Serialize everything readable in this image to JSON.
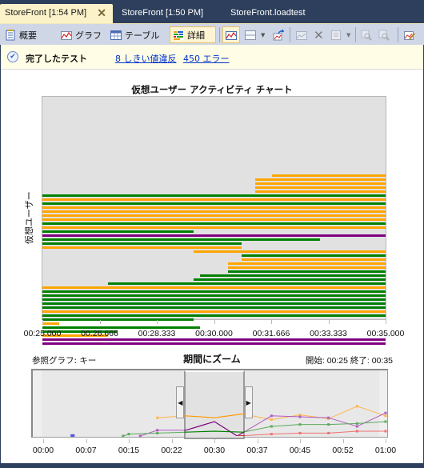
{
  "tabs": [
    {
      "label": "StoreFront [1:54 PM]",
      "active": true,
      "closable": true
    },
    {
      "label": "StoreFront [1:50 PM]",
      "active": false
    },
    {
      "label": "StoreFront.loadtest",
      "active": false
    }
  ],
  "toolbar": {
    "summary_label": "概要",
    "graph_label": "グラフ",
    "table_label": "テーブル",
    "details_label": "詳細",
    "icons": [
      "summary-icon",
      "graph-icon",
      "table-icon",
      "details-icon",
      "graph-view-icon",
      "layout-icon",
      "dropdown-icon",
      "export-icon",
      "add-graph-icon",
      "delete-icon",
      "properties-icon",
      "dropdown-icon",
      "zoom-in-icon",
      "zoom-out-icon",
      "edit-graph-icon"
    ]
  },
  "infobar": {
    "status": "完了したテスト",
    "threshold_link": "8 しきい値違反",
    "errors_link": "450 エラー"
  },
  "chart_data": {
    "type": "bar",
    "title": "仮想ユーザー アクティビティ チャート",
    "ylabel": "仮想ユーザー",
    "xlabel": "",
    "x_range_seconds": [
      25,
      35
    ],
    "x_tick_labels": [
      "00:25.000",
      "00:26.666",
      "00:28.333",
      "00:30.000",
      "00:31.666",
      "00:33.333",
      "00:35.000"
    ],
    "colors": {
      "passed": "#008000",
      "other": "#ffa500",
      "failed": "#800080"
    },
    "series": [
      {
        "color": "orange",
        "start": 31.7,
        "end": 35
      },
      {
        "color": "orange",
        "start": 31.2,
        "end": 35
      },
      {
        "color": "orange",
        "start": 31.2,
        "end": 35
      },
      {
        "color": "orange",
        "start": 31.2,
        "end": 35
      },
      {
        "color": "orange",
        "start": 31.2,
        "end": 35
      },
      {
        "color": "green",
        "start": 25,
        "end": 35
      },
      {
        "color": "orange",
        "start": 25,
        "end": 35
      },
      {
        "color": "green",
        "start": 25,
        "end": 35
      },
      {
        "color": "orange",
        "start": 25,
        "end": 35
      },
      {
        "color": "orange",
        "start": 25,
        "end": 35
      },
      {
        "color": "orange",
        "start": 25,
        "end": 35
      },
      {
        "color": "orange",
        "start": 25,
        "end": 35
      },
      {
        "color": "green",
        "start": 25,
        "end": 35
      },
      {
        "color": "orange",
        "start": 25,
        "end": 35
      },
      {
        "color": "green",
        "start": 25,
        "end": 29.4
      },
      {
        "color": "purple",
        "start": 25,
        "end": 35
      },
      {
        "color": "green",
        "start": 25,
        "end": 33.1
      },
      {
        "color": "green",
        "start": 25,
        "end": 30.8
      },
      {
        "color": "orange",
        "start": 25,
        "end": 30.8
      },
      {
        "color": "orange",
        "start": 29.4,
        "end": 35
      },
      {
        "color": "green",
        "start": 30.8,
        "end": 35
      },
      {
        "color": "orange",
        "start": 30.8,
        "end": 35
      },
      {
        "color": "orange",
        "start": 30.4,
        "end": 35
      },
      {
        "color": "orange",
        "start": 30.4,
        "end": 35
      },
      {
        "color": "green",
        "start": 30.4,
        "end": 35
      },
      {
        "color": "green",
        "start": 29.6,
        "end": 35
      },
      {
        "color": "green",
        "start": 29.4,
        "end": 35
      },
      {
        "color": "green",
        "start": 26.9,
        "end": 35
      },
      {
        "color": "orange",
        "start": 25,
        "end": 35
      },
      {
        "color": "green",
        "start": 25,
        "end": 35
      },
      {
        "color": "green",
        "start": 25,
        "end": 35
      },
      {
        "color": "green",
        "start": 25,
        "end": 35
      },
      {
        "color": "green",
        "start": 25,
        "end": 35
      },
      {
        "color": "green",
        "start": 25,
        "end": 35
      },
      {
        "color": "orange",
        "start": 25,
        "end": 35
      },
      {
        "color": "green",
        "start": 25,
        "end": 35
      },
      {
        "color": "green",
        "start": 25,
        "end": 29.4
      },
      {
        "color": "orange",
        "start": 25,
        "end": 25.5
      },
      {
        "color": "green",
        "start": 25,
        "end": 29.6
      },
      {
        "color": "green",
        "start": 25,
        "end": 27.2
      },
      {
        "color": "orange",
        "start": 25,
        "end": 26.9
      },
      {
        "color": "purple",
        "start": 25,
        "end": 35
      },
      {
        "color": "purple",
        "start": 25,
        "end": 35
      }
    ]
  },
  "zoom_panel": {
    "reference_label": "参照グラフ: キー",
    "title": "期間にズーム",
    "range_label": "開始: 00:25 終了: 00:35",
    "selection_start_seconds": 25,
    "selection_end_seconds": 35,
    "x_range_seconds": [
      0,
      60
    ],
    "x_tick_labels": [
      "00:00",
      "00:07",
      "00:15",
      "00:22",
      "00:30",
      "00:37",
      "00:45",
      "00:52",
      "01:00"
    ],
    "lines": [
      {
        "name": "orange",
        "color": "#ffb347",
        "points": [
          [
            20,
            0.38
          ],
          [
            25,
            0.42
          ],
          [
            30,
            0.38
          ],
          [
            35,
            0.46
          ],
          [
            40,
            0.34
          ],
          [
            45,
            0.44
          ],
          [
            50,
            0.36
          ],
          [
            55,
            0.62
          ],
          [
            60,
            0.42
          ]
        ]
      },
      {
        "name": "purple",
        "color": "#b05cc0",
        "points": [
          [
            17,
            0
          ],
          [
            20,
            0.12
          ],
          [
            25,
            0.12
          ],
          [
            30,
            0.3
          ],
          [
            34,
            0
          ],
          [
            40,
            0.42
          ],
          [
            45,
            0.4
          ],
          [
            50,
            0.38
          ],
          [
            55,
            0.2
          ],
          [
            60,
            0.48
          ]
        ]
      },
      {
        "name": "green",
        "color": "#5caa5c",
        "points": [
          [
            14,
            0
          ],
          [
            15,
            0.04
          ],
          [
            20,
            0.06
          ],
          [
            25,
            0.08
          ],
          [
            30,
            0.1
          ],
          [
            35,
            0.08
          ],
          [
            40,
            0.2
          ],
          [
            45,
            0.24
          ],
          [
            50,
            0.24
          ],
          [
            55,
            0.26
          ],
          [
            60,
            0.3
          ]
        ]
      },
      {
        "name": "red",
        "color": "#f07070",
        "points": [
          [
            34,
            0
          ],
          [
            40,
            0.04
          ],
          [
            45,
            0.06
          ],
          [
            50,
            0.06
          ],
          [
            55,
            0.1
          ],
          [
            60,
            0.1
          ]
        ]
      },
      {
        "name": "blue",
        "color": "#5050e0",
        "points": [
          [
            5,
            0.01
          ],
          [
            5.3,
            0.01
          ]
        ]
      }
    ]
  }
}
